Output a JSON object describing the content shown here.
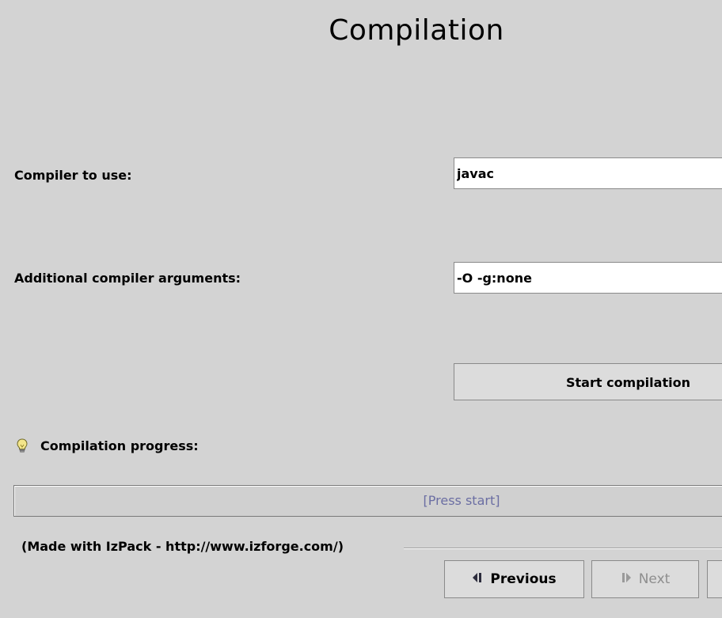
{
  "header": {
    "title": "Compilation"
  },
  "form": {
    "compiler_label": "Compiler to use:",
    "compiler_value": "javac",
    "args_label": "Additional compiler arguments:",
    "args_value": "-O -g:none",
    "start_button": "Start compilation"
  },
  "progress": {
    "label": "Compilation progress:",
    "icon": "lightbulb-icon",
    "status_text": "[Press start]",
    "value": 0
  },
  "footer": {
    "made_with": "(Made with IzPack - http://www.izforge.com/)",
    "previous_label": "Previous",
    "next_label": "Next",
    "previous_icon": "previous-arrow-icon",
    "next_icon": "next-arrow-icon"
  },
  "colors": {
    "background": "#d3d3d3",
    "progress_text": "#6b6ea3",
    "disabled_text": "#8e8e8e"
  }
}
